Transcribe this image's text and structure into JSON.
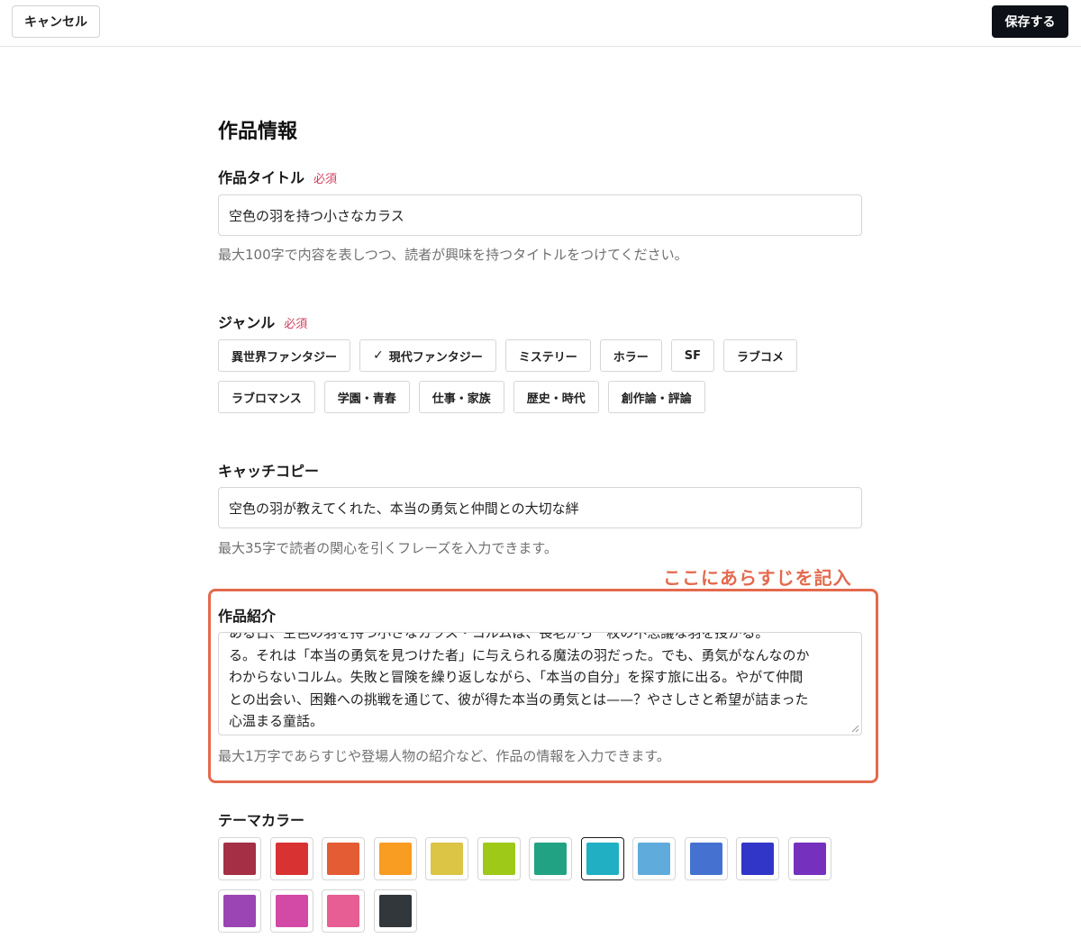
{
  "toolbar": {
    "cancel_label": "キャンセル",
    "save_label": "保存する"
  },
  "section_title": "作品情報",
  "title_field": {
    "label": "作品タイトル",
    "required": "必須",
    "value": "空色の羽を持つ小さなカラス",
    "hint": "最大100字で内容を表しつつ、読者が興味を持つタイトルをつけてください。"
  },
  "genre": {
    "label": "ジャンル",
    "required": "必須",
    "selected_mark": "✓",
    "row1": [
      "異世界ファンタジー",
      "現代ファンタジー",
      "ミステリー",
      "ホラー",
      "SF",
      "ラブコメ"
    ],
    "row2": [
      "ラブロマンス",
      "学園・青春",
      "仕事・家族",
      "歴史・時代",
      "創作論・評論"
    ],
    "selected": "現代ファンタジー"
  },
  "catchcopy": {
    "label": "キャッチコピー",
    "value": "空色の羽が教えてくれた、本当の勇気と仲間との大切な絆",
    "hint": "最大35字で読者の関心を引くフレーズを入力できます。"
  },
  "annotation": {
    "text": "ここにあらすじを記入",
    "color": "#e46a4e"
  },
  "intro": {
    "label": "作品紹介",
    "lines": [
      "ある日、空色の羽を持つ小さなカラス・コルムは、長老から一枚の不思議な羽を授かる。",
      "る。それは「本当の勇気を見つけた者」に与えられる魔法の羽だった。でも、勇気がなんなのか",
      "わからないコルム。失敗と冒険を繰り返しながら、「本当の自分」を探す旅に出る。やがて仲間",
      "との出会い、困難への挑戦を通じて、彼が得た本当の勇気とは——？やさしさと希望が詰まった",
      "心温まる童話。"
    ],
    "hint": "最大1万字であらすじや登場人物の紹介など、作品の情報を入力できます。"
  },
  "theme": {
    "label": "テーマカラー",
    "row1": [
      "#a52f45",
      "#d93232",
      "#e45c33",
      "#f99c22",
      "#dcc445",
      "#9ec919",
      "#20a283",
      "#20afc3",
      "#5fabdb",
      "#4572d1",
      "#3136c9",
      "#7530be"
    ],
    "row2": [
      "#9a45b3",
      "#d349a6",
      "#e65e94",
      "#32373b"
    ],
    "selected": "#20afc3"
  }
}
